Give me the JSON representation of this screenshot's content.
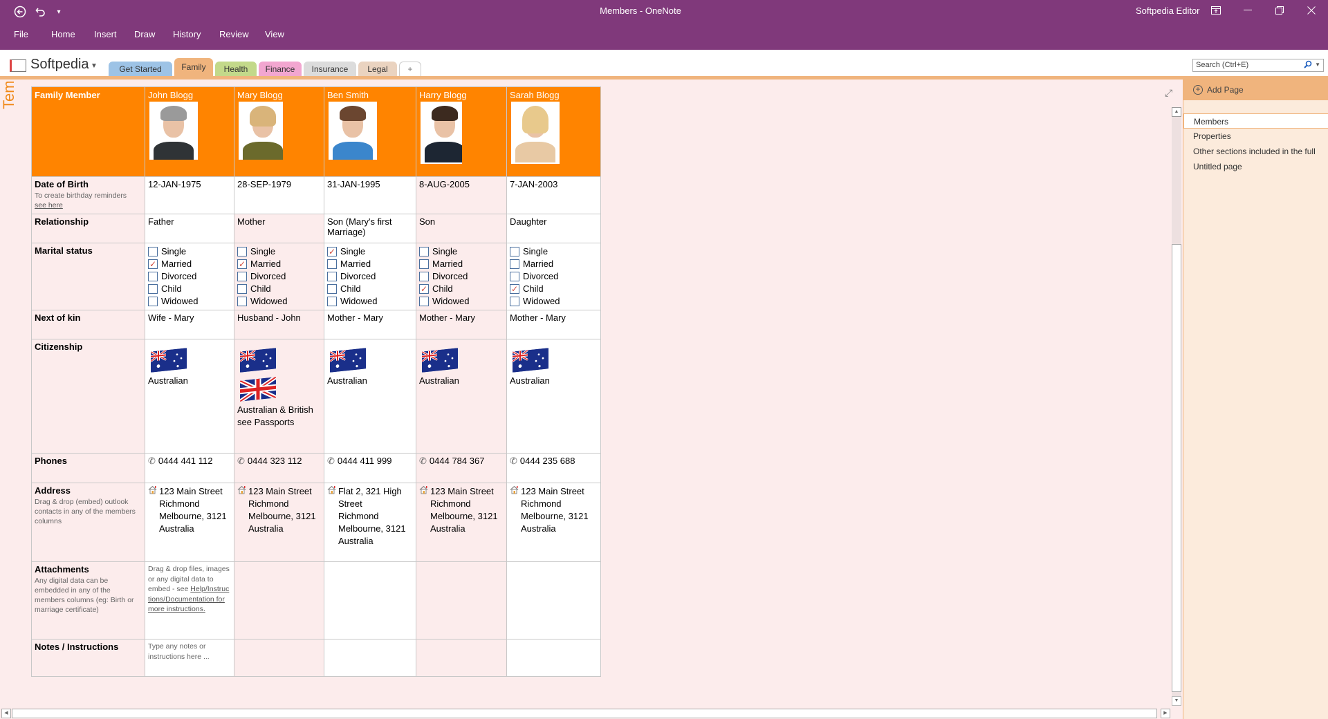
{
  "window": {
    "title": "Members  -  OneNote",
    "user": "Softpedia Editor",
    "qat": {
      "back_icon": "back-arrow-icon",
      "undo_icon": "undo-icon",
      "customize_icon": "customize-qat-icon"
    },
    "controls": {
      "ribbon_display": "ribbon-display-icon",
      "minimize": "minimize-icon",
      "restore": "restore-icon",
      "close": "close-icon"
    }
  },
  "menu": [
    "File",
    "Home",
    "Insert",
    "Draw",
    "History",
    "Review",
    "View"
  ],
  "notebook": {
    "name": "Softpedia"
  },
  "sections": [
    {
      "label": "Get Started",
      "color": "#9dc3e6"
    },
    {
      "label": "Family",
      "color": "#f0b47d",
      "active": true
    },
    {
      "label": "Health",
      "color": "#c3d98a"
    },
    {
      "label": "Finance",
      "color": "#f2a6d0"
    },
    {
      "label": "Insurance",
      "color": "#d9d9d9"
    },
    {
      "label": "Legal",
      "color": "#e7cbb3"
    },
    {
      "label": "+",
      "color": "#ffffff"
    }
  ],
  "search": {
    "placeholder": "Search (Ctrl+E)"
  },
  "side_label": "Tem",
  "table": {
    "header_label": "Family Member",
    "header_color": "#ff8400",
    "members": [
      {
        "name": "John Blogg",
        "photo": "john-photo",
        "dob": "12-JAN-1975",
        "relationship": "Father",
        "marital": "Married",
        "next_of_kin": "Wife - Mary",
        "flags": [
          "au"
        ],
        "citizenship": [
          "Australian"
        ],
        "phone": "0444 441 112",
        "address": [
          "123 Main Street",
          "Richmond",
          "Melbourne, 3121",
          "Australia"
        ]
      },
      {
        "name": "Mary Blogg",
        "photo": "mary-photo",
        "dob": "28-SEP-1979",
        "relationship": "Mother",
        "marital": "Married",
        "next_of_kin": "Husband - John",
        "flags": [
          "au",
          "uk"
        ],
        "citizenship": [
          "Australian & British",
          "see Passports"
        ],
        "phone": "0444 323 112",
        "address": [
          "123 Main Street",
          "Richmond",
          "Melbourne, 3121",
          "Australia"
        ]
      },
      {
        "name": "Ben Smith",
        "photo": "ben-photo",
        "dob": "31-JAN-1995",
        "relationship": "Son (Mary's first Marriage)",
        "marital": "Single",
        "next_of_kin": "Mother - Mary",
        "flags": [
          "au"
        ],
        "citizenship": [
          "Australian"
        ],
        "phone": "0444 411 999",
        "address": [
          "Flat 2, 321 High Street",
          "Richmond",
          "Melbourne, 3121",
          "Australia"
        ]
      },
      {
        "name": "Harry Blogg",
        "photo": "harry-photo",
        "dob": "8-AUG-2005",
        "relationship": "Son",
        "marital": "Child",
        "next_of_kin": "Mother - Mary",
        "flags": [
          "au"
        ],
        "citizenship": [
          "Australian"
        ],
        "phone": "0444 784 367",
        "address": [
          "123 Main Street",
          "Richmond",
          "Melbourne, 3121",
          "Australia"
        ]
      },
      {
        "name": "Sarah Blogg",
        "photo": "sarah-photo",
        "dob": "7-JAN-2003",
        "relationship": "Daughter",
        "marital": "Child",
        "next_of_kin": "Mother - Mary",
        "flags": [
          "au"
        ],
        "citizenship": [
          "Australian"
        ],
        "phone": "0444 235 688",
        "address": [
          "123 Main Street",
          "Richmond",
          "Melbourne, 3121",
          "Australia"
        ]
      }
    ],
    "marital_options": [
      "Single",
      "Married",
      "Divorced",
      "Child",
      "Widowed"
    ],
    "rows": {
      "dob": {
        "label": "Date of Birth",
        "hint": "To create birthday reminders",
        "hint_link": "see here"
      },
      "relationship": {
        "label": "Relationship"
      },
      "marital": {
        "label": "Marital status"
      },
      "next_of_kin": {
        "label": "Next of kin"
      },
      "citizenship": {
        "label": "Citizenship"
      },
      "phones": {
        "label": "Phones"
      },
      "address": {
        "label": "Address",
        "hint": "Drag & drop (embed) outlook contacts in any of the members columns"
      },
      "attachments": {
        "label": "Attachments",
        "hint": "Any digital data can be embedded in any of the members columns (eg: Birth or marriage certificate)",
        "cell_text": "Drag & drop files, images or any digital data to embed -  see ",
        "cell_link": "Help/Instructions/Documentation for more instructions."
      },
      "notes": {
        "label": "Notes / Instructions",
        "cell_text": "Type any notes or instructions here ..."
      }
    }
  },
  "pages_panel": {
    "add_page": "Add Page",
    "pages": [
      "Members",
      "Properties",
      "Other sections included in the full",
      "Untitled page"
    ],
    "selected": 0
  }
}
